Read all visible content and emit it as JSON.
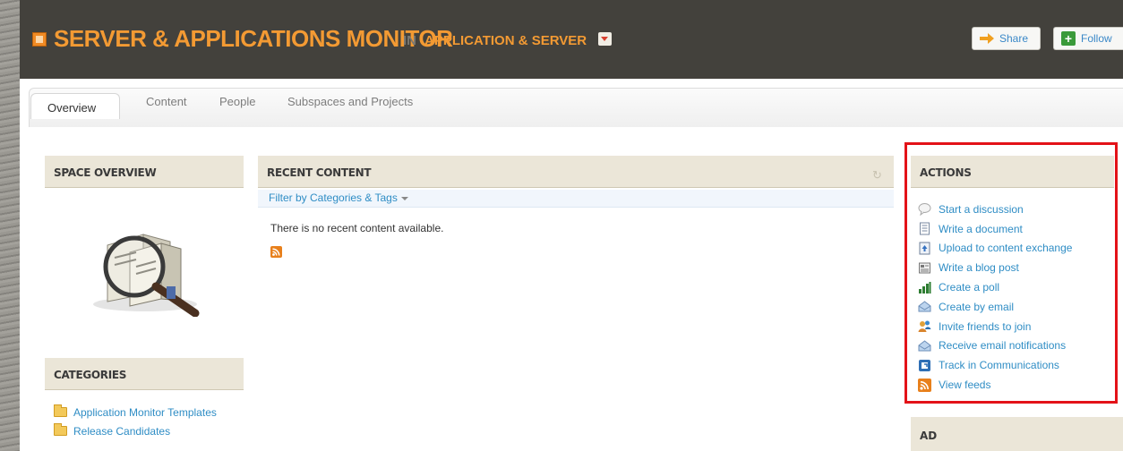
{
  "header": {
    "title": "SERVER & APPLICATIONS MONITOR",
    "in_label": "IN",
    "parent_space": "APPLICATION & SERVER",
    "share_label": "Share",
    "follow_label": "Follow"
  },
  "tabs": [
    {
      "label": "Overview",
      "active": true
    },
    {
      "label": "Content",
      "active": false
    },
    {
      "label": "People",
      "active": false
    },
    {
      "label": "Subspaces and Projects",
      "active": false
    }
  ],
  "space_overview": {
    "title": "SPACE OVERVIEW"
  },
  "categories": {
    "title": "CATEGORIES",
    "items": [
      {
        "label": "Application Monitor Templates",
        "icon": "folder-icon"
      },
      {
        "label": "Release Candidates",
        "icon": "folder-icon"
      }
    ]
  },
  "recent_content": {
    "title": "RECENT CONTENT",
    "filter_label": "Filter by Categories & Tags",
    "empty_message": "There is no recent content available."
  },
  "actions": {
    "title": "ACTIONS",
    "items": [
      {
        "label": "Start a discussion",
        "icon": "speech-bubble-icon"
      },
      {
        "label": "Write a document",
        "icon": "document-icon"
      },
      {
        "label": "Upload to content exchange",
        "icon": "upload-icon"
      },
      {
        "label": "Write a blog post",
        "icon": "blog-icon"
      },
      {
        "label": "Create a poll",
        "icon": "poll-icon"
      },
      {
        "label": "Create by email",
        "icon": "email-icon"
      },
      {
        "label": "Invite friends to join",
        "icon": "invite-icon"
      },
      {
        "label": "Receive email notifications",
        "icon": "email-notification-icon"
      },
      {
        "label": "Track in Communications",
        "icon": "track-icon"
      },
      {
        "label": "View feeds",
        "icon": "rss-icon"
      }
    ]
  },
  "ad": {
    "title": "AD"
  },
  "colors": {
    "header_bg": "#43413c",
    "brand_orange": "#f39a33",
    "link_blue": "#2f8dc5",
    "widget_header_bg": "#ebe6d8",
    "highlight_red": "#e31218"
  }
}
